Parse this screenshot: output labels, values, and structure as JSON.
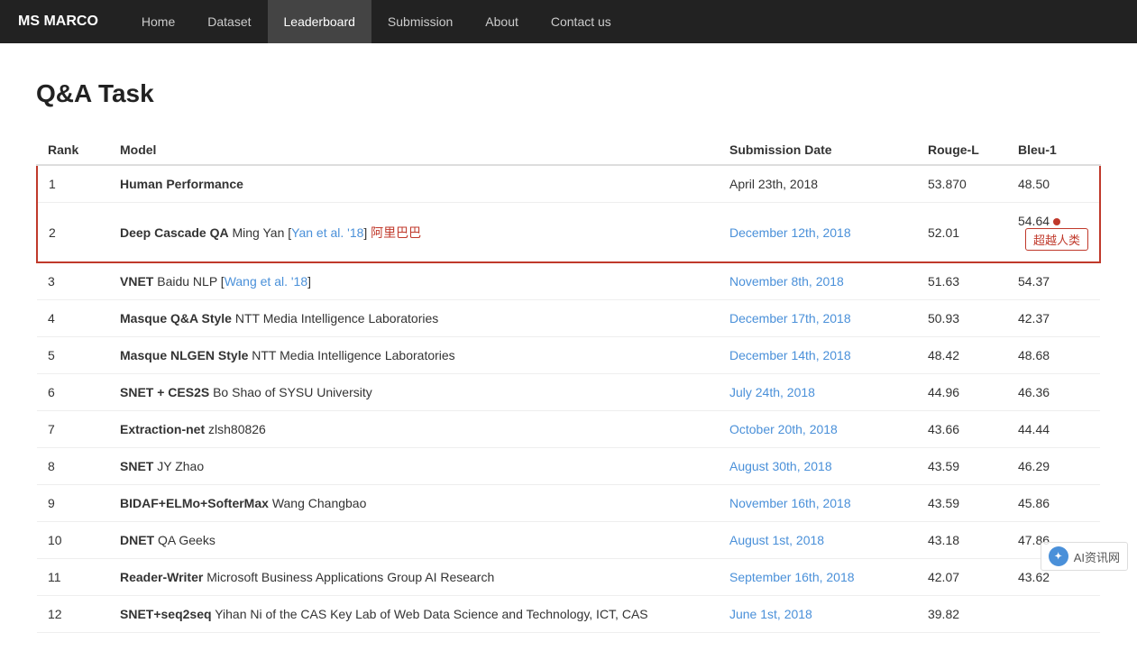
{
  "brand": "MS MARCO",
  "nav": {
    "items": [
      {
        "label": "Home",
        "active": false
      },
      {
        "label": "Dataset",
        "active": false
      },
      {
        "label": "Leaderboard",
        "active": true
      },
      {
        "label": "Submission",
        "active": false
      },
      {
        "label": "About",
        "active": false
      },
      {
        "label": "Contact us",
        "active": false
      }
    ]
  },
  "page_title": "Q&A Task",
  "table": {
    "headers": [
      "Rank",
      "Model",
      "Submission Date",
      "Rouge-L",
      "Bleu-1"
    ],
    "rows": [
      {
        "rank": "1",
        "model_bold": "Human Performance",
        "model_extra": "",
        "date": "April 23th, 2018",
        "date_link": false,
        "rouge": "53.870",
        "bleu": "48.50",
        "highlight": true,
        "exceed": false
      },
      {
        "rank": "2",
        "model_bold": "Deep Cascade QA",
        "model_extra": "Ming Yan [Yan et al. '18]   阿里巴巴",
        "model_extra_link": "Yan et al. '18",
        "model_extra_chinese": "阿里巴巴",
        "date": "December 12th, 2018",
        "date_link": true,
        "rouge": "52.01",
        "bleu": "54.64",
        "highlight": true,
        "exceed": true,
        "exceed_label": "超越人类"
      },
      {
        "rank": "3",
        "model_bold": "VNET",
        "model_extra": "Baidu NLP [Wang et al. '18]",
        "model_extra_link": "Wang et al. '18",
        "date": "November 8th, 2018",
        "date_link": true,
        "rouge": "51.63",
        "bleu": "54.37",
        "highlight": false,
        "exceed": false
      },
      {
        "rank": "4",
        "model_bold": "Masque Q&A Style",
        "model_extra": "NTT Media Intelligence Laboratories",
        "date": "December 17th, 2018",
        "date_link": true,
        "rouge": "50.93",
        "bleu": "42.37",
        "highlight": false,
        "exceed": false
      },
      {
        "rank": "5",
        "model_bold": "Masque NLGEN Style",
        "model_extra": "NTT Media Intelligence Laboratories",
        "date": "December 14th, 2018",
        "date_link": true,
        "rouge": "48.42",
        "bleu": "48.68",
        "highlight": false,
        "exceed": false
      },
      {
        "rank": "6",
        "model_bold": "SNET + CES2S",
        "model_extra": "Bo Shao of SYSU University",
        "date": "July 24th, 2018",
        "date_link": true,
        "rouge": "44.96",
        "bleu": "46.36",
        "highlight": false,
        "exceed": false
      },
      {
        "rank": "7",
        "model_bold": "Extraction-net",
        "model_extra": "zlsh80826",
        "date": "October 20th, 2018",
        "date_link": true,
        "rouge": "43.66",
        "bleu": "44.44",
        "highlight": false,
        "exceed": false
      },
      {
        "rank": "8",
        "model_bold": "SNET",
        "model_extra": "JY Zhao",
        "date": "August 30th, 2018",
        "date_link": true,
        "rouge": "43.59",
        "bleu": "46.29",
        "highlight": false,
        "exceed": false
      },
      {
        "rank": "9",
        "model_bold": "BIDAF+ELMo+SofterMax",
        "model_extra": "Wang Changbao",
        "date": "November 16th, 2018",
        "date_link": true,
        "rouge": "43.59",
        "bleu": "45.86",
        "highlight": false,
        "exceed": false
      },
      {
        "rank": "10",
        "model_bold": "DNET",
        "model_extra": "QA Geeks",
        "date": "August 1st, 2018",
        "date_link": true,
        "rouge": "43.18",
        "bleu": "47.86",
        "highlight": false,
        "exceed": false
      },
      {
        "rank": "11",
        "model_bold": "Reader-Writer",
        "model_extra": "Microsoft Business Applications Group AI Research",
        "date": "September 16th, 2018",
        "date_link": true,
        "rouge": "42.07",
        "bleu": "43.62",
        "highlight": false,
        "exceed": false
      },
      {
        "rank": "12",
        "model_bold": "SNET+seq2seq",
        "model_extra": "Yihan Ni of the CAS Key Lab of Web Data Science and Technology, ICT, CAS",
        "date": "June 1st, 2018",
        "date_link": true,
        "rouge": "39.82",
        "bleu": "",
        "highlight": false,
        "exceed": false
      }
    ]
  },
  "watermark": {
    "text": "AI资讯网",
    "icon": "✦"
  }
}
